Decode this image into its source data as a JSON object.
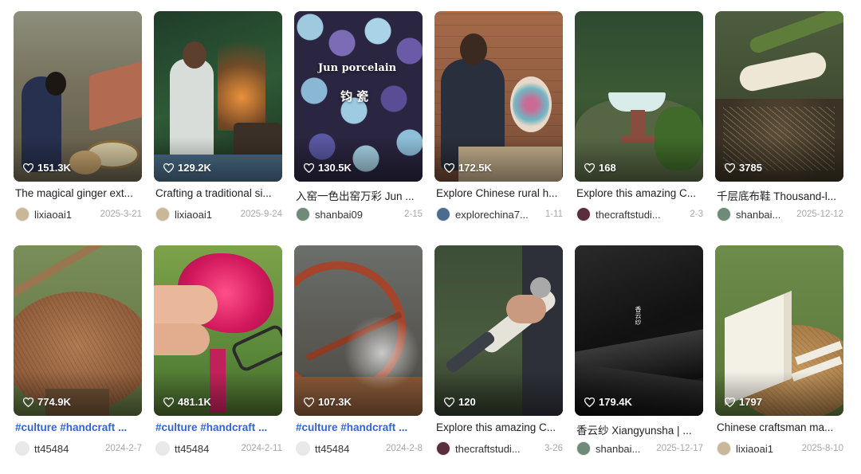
{
  "cards": [
    {
      "likes": "151.3K",
      "title": "The magical ginger ext...",
      "title_style": "normal",
      "author": "lixiaoai1",
      "date": "2025-3-21",
      "avatar_color": "#c9b79a",
      "scene": "ginger"
    },
    {
      "likes": "129.2K",
      "title": "Crafting a traditional si...",
      "title_style": "normal",
      "author": "lixiaoai1",
      "date": "2025-9-24",
      "avatar_color": "#c9b79a",
      "scene": "forge"
    },
    {
      "likes": "130.5K",
      "title": "入窑一色出窑万彩 Jun ...",
      "title_style": "normal",
      "author": "shanbai09",
      "date": "2-15",
      "avatar_color": "#6f8a78",
      "scene": "porcelain",
      "overlay_line1": "Jun porcelain",
      "overlay_line2": "钧 瓷"
    },
    {
      "likes": "172.5K",
      "title": "Explore Chinese rural h...",
      "title_style": "normal",
      "author": "explorechina7...",
      "date": "1-11",
      "avatar_color": "#4d6b8f",
      "scene": "vase"
    },
    {
      "likes": "168",
      "title": "Explore this amazing C...",
      "title_style": "normal",
      "author": "thecraftstudi...",
      "date": "2-3",
      "avatar_color": "#5a2e3a",
      "scene": "cup"
    },
    {
      "likes": "3785",
      "title": "千层底布鞋 Thousand-l...",
      "title_style": "normal",
      "author": "shanbai...",
      "date": "2025-12-12",
      "avatar_color": "#6f8a78",
      "scene": "bamboo"
    },
    {
      "likes": "774.9K",
      "title": "#culture #handcraft ...",
      "title_style": "tag",
      "author": "tt45484",
      "date": "2024-2-7",
      "avatar_color": "#e9e9e9",
      "scene": "basket"
    },
    {
      "likes": "481.1K",
      "title": "#culture #handcraft ...",
      "title_style": "tag",
      "author": "tt45484",
      "date": "2024-2-11",
      "avatar_color": "#e9e9e9",
      "scene": "flower"
    },
    {
      "likes": "107.3K",
      "title": "#culture #handcraft ...",
      "title_style": "tag",
      "author": "tt45484",
      "date": "2024-2-8",
      "avatar_color": "#e9e9e9",
      "scene": "waterwheel"
    },
    {
      "likes": "120",
      "title": "Explore this amazing C...",
      "title_style": "normal",
      "author": "thecraftstudi...",
      "date": "3-26",
      "avatar_color": "#5a2e3a",
      "scene": "sword"
    },
    {
      "likes": "179.4K",
      "title": "香云纱 Xiangyunsha | ...",
      "title_style": "normal",
      "author": "shanbai...",
      "date": "2025-12-17",
      "avatar_color": "#6f8a78",
      "scene": "silk",
      "overlay_line1": "香云纱"
    },
    {
      "likes": "1797",
      "title": "Chinese craftsman ma...",
      "title_style": "normal",
      "author": "lixiaoai1",
      "date": "2025-8-10",
      "avatar_color": "#c9b79a",
      "scene": "tofu"
    }
  ]
}
